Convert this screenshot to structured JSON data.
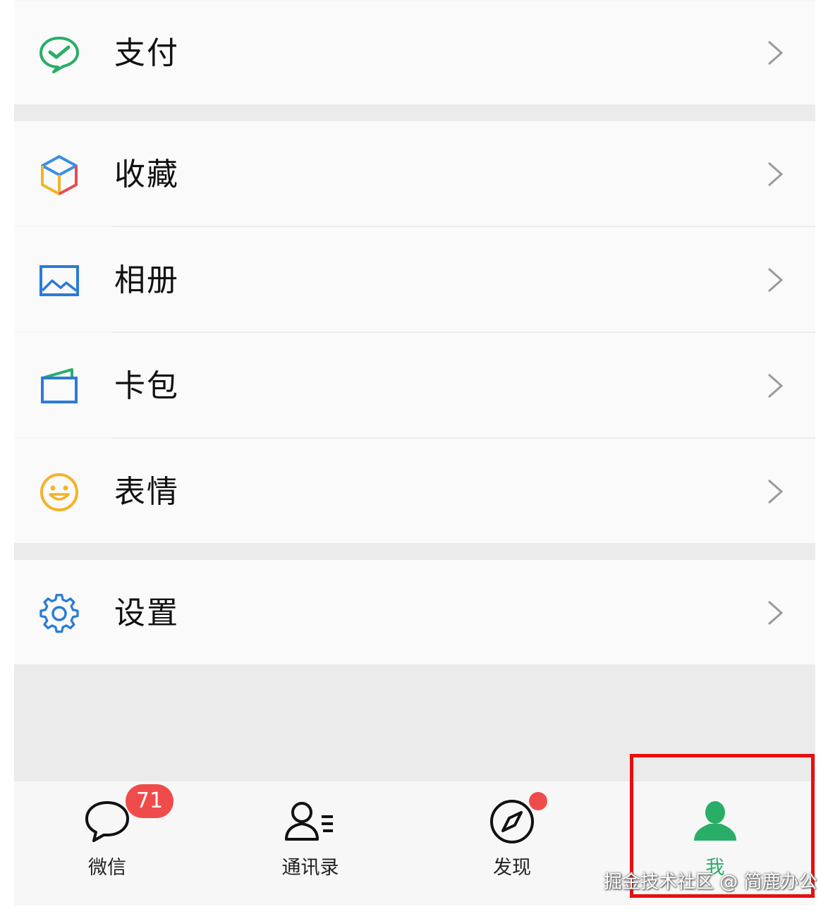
{
  "menu": {
    "pay": {
      "label": "支付",
      "icon": "wechat-pay-icon"
    },
    "favorites": {
      "label": "收藏",
      "icon": "cube-icon"
    },
    "album": {
      "label": "相册",
      "icon": "picture-icon"
    },
    "cards": {
      "label": "卡包",
      "icon": "wallet-icon"
    },
    "stickers": {
      "label": "表情",
      "icon": "smiley-icon"
    },
    "settings": {
      "label": "设置",
      "icon": "gear-icon"
    }
  },
  "tabbar": {
    "chats": {
      "label": "微信",
      "badge": "71",
      "icon": "chat-bubble-icon"
    },
    "contacts": {
      "label": "通讯录",
      "icon": "contacts-icon"
    },
    "discover": {
      "label": "发现",
      "icon": "compass-icon",
      "has_dot": true
    },
    "me": {
      "label": "我",
      "icon": "person-icon",
      "selected": true
    }
  },
  "watermark": "掘金技术社区 @ 简鹿办公",
  "colors": {
    "accent": "#2aae67",
    "badge": "#f04b4b",
    "highlight": "#ea0e0e"
  }
}
